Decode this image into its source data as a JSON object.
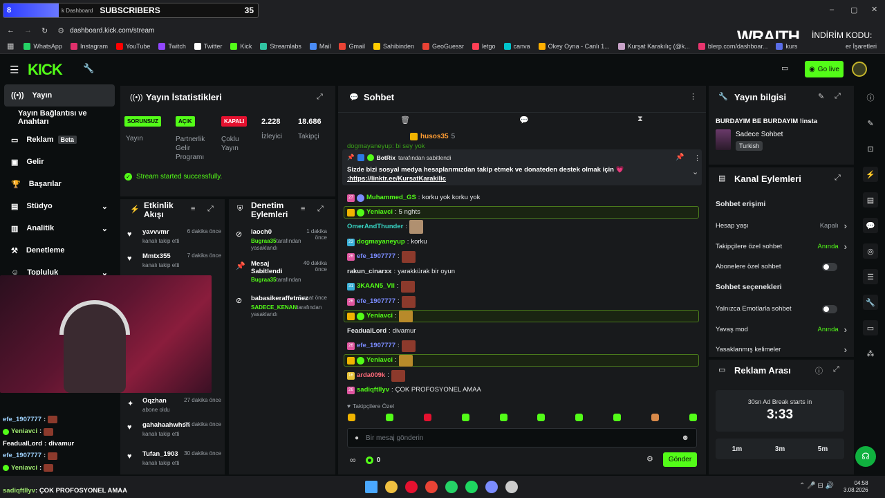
{
  "overlay": {
    "number": "8",
    "subs_label": "SUBSCRIBERS",
    "subs_count": "35",
    "brand": "WRAITH.",
    "promo": "İNDİRİM KODU:",
    "code": "QQ"
  },
  "browser": {
    "tab_fragment": "k Dashboard",
    "url": "dashboard.kick.com/stream",
    "bookmarks": [
      "WhatsApp",
      "Instagram",
      "YouTube",
      "Twitch",
      "Twitter",
      "Kick",
      "Streamlabs",
      "Mail",
      "Gmail",
      "Sahibinden",
      "GeoGuessr",
      "letgo",
      "canva",
      "Okey Oyna - Canlı 1...",
      "Kurşat Karakılıç (@k...",
      "blerp.com/dashboar...",
      "kurs"
    ],
    "bookmarks_end": "er İşaretleri"
  },
  "header": {
    "golive": "Go live"
  },
  "sidebar": {
    "items": [
      {
        "label": "Yayın"
      },
      {
        "label": "Yayın Bağlantısı ve Anahtarı"
      },
      {
        "label": "Reklam",
        "badge": "Beta"
      },
      {
        "label": "Gelir"
      },
      {
        "label": "Başarılar"
      },
      {
        "label": "Stüdyo"
      },
      {
        "label": "Analitik"
      },
      {
        "label": "Denetleme"
      },
      {
        "label": "Topluluk"
      }
    ]
  },
  "stats": {
    "title": "Yayın İstatistikleri",
    "cells": [
      {
        "badge": "SORUNSUZ",
        "label": "Yayın"
      },
      {
        "badge": "AÇIK",
        "label": "Partnerlik Gelir Programı"
      },
      {
        "badge": "KAPALI",
        "label": "Çoklu Yayın"
      },
      {
        "value": "2.228",
        "label": "İzleyici"
      },
      {
        "value": "18.686",
        "label": "Takipçi"
      }
    ],
    "success": "Stream started successfully."
  },
  "activity": {
    "title": "Etkinlik Akışı",
    "items": [
      {
        "name": "yavvvmr",
        "time": "6 dakika önce",
        "action": "kanalı takip etti"
      },
      {
        "name": "Mmtx355",
        "time": "7 dakika önce",
        "action": "kanalı takip etti"
      },
      {
        "name": "Oqzhan",
        "time": "27 dakika önce",
        "action": "abone oldu"
      },
      {
        "name": "gahahaahwhsh",
        "time": "27 dakika önce",
        "action": "kanalı takip etti"
      },
      {
        "name": "Tufan_1903",
        "time": "30 dakika önce",
        "action": "kanalı takip etti"
      }
    ]
  },
  "moderation": {
    "title": "Denetim Eylemleri",
    "items": [
      {
        "name": "laoch0",
        "time": "1 dakika önce",
        "by": "Bugraa35",
        "suffix": "tarafından yasaklandı"
      },
      {
        "name": "Mesaj Sabitlendi",
        "time": "40 dakika önce",
        "by": "Bugraa35",
        "suffix": "tarafından"
      },
      {
        "name": "babasikeraffetmez",
        "time": "3 saat önce",
        "by": "SADECE_KENAN",
        "suffix": "tarafından yasaklandı"
      }
    ]
  },
  "chat": {
    "title": "Sohbet",
    "top_user": "husos35",
    "top_count": "5",
    "partial": "dogmayaneyup: bi sey yok",
    "pinned_by": "BotRix",
    "pinned_suffix": "tarafından sabitlendi",
    "pinned_text": "Sizde bizi sosyal medya hesaplarımızdan takip etmek ve donateden destek olmak için 💗",
    "pinned_link": ";https://linktr.ee/KursatKarakilic",
    "messages": [
      {
        "user": "Muhammed_GS",
        "text": "korku yok korku yok",
        "color": "#53fc18",
        "badge": "27"
      },
      {
        "user": "Yeniavci",
        "text": "5 nghts",
        "color": "#53fc18",
        "hl": true
      },
      {
        "user": "OmerAndThunder",
        "text": "",
        "color": "#38d4c4",
        "emote": true
      },
      {
        "user": "dogmayaneyup",
        "text": "korku",
        "color": "#53fc18",
        "badge": "23"
      },
      {
        "user": "efe_1907777",
        "text": "",
        "color": "#7b8cff",
        "emote": true,
        "badge": "26"
      },
      {
        "user": "rakun_cinarxx",
        "text": "yarakkürak bir oyun",
        "color": "#e6e8ea"
      },
      {
        "user": "3KAAN5_Vll",
        "text": "",
        "color": "#53fc18",
        "emote": true,
        "badge": "31"
      },
      {
        "user": "efe_1907777",
        "text": "",
        "color": "#7b8cff",
        "emote": true,
        "badge": "26"
      },
      {
        "user": "Yeniavci",
        "text": "",
        "color": "#53fc18",
        "emote": true,
        "hl": true
      },
      {
        "user": "FeadualLord",
        "text": "divamur",
        "color": "#e6e8ea"
      },
      {
        "user": "efe_1907777",
        "text": "",
        "color": "#7b8cff",
        "emote": true,
        "badge": "26"
      },
      {
        "user": "Yeniavci",
        "text": "",
        "color": "#53fc18",
        "emote": true,
        "hl": true
      },
      {
        "user": "arda009k",
        "text": "",
        "color": "#ff6b7a",
        "emote": true,
        "badge": "16"
      },
      {
        "user": "sadiqftllyv",
        "text": "ÇOK PROFOSYONEL AMAA",
        "color": "#53fc18",
        "badge": "26"
      }
    ],
    "followers_only": "Takipçilere Özel",
    "input_placeholder": "Bir mesaj gönderin",
    "points": "0",
    "send": "Gönder"
  },
  "overlay_chat": [
    {
      "user": "efe_1907777",
      "text": ""
    },
    {
      "user": "Yeniavci",
      "text": ""
    },
    {
      "user": "FeadualLord",
      "text": "divamur"
    },
    {
      "user": "efe_1907777",
      "text": ""
    },
    {
      "user": "Yeniavci",
      "text": ""
    },
    {
      "user": "arda009k",
      "text": ""
    },
    {
      "user": "sadiqftllyv",
      "text": "ÇOK PROFOSYONEL AMAA"
    }
  ],
  "info": {
    "title": "Yayın bilgisi",
    "stream_title": "BURDAYIM BE BURDAYIM !insta",
    "category": "Sadece Sohbet",
    "language": "Turkish"
  },
  "channel": {
    "title": "Kanal Eylemleri",
    "access": "Sohbet erişimi",
    "rows1": [
      {
        "label": "Hesap yaşı",
        "value": "Kapalı"
      },
      {
        "label": "Takipçilere özel sohbet",
        "value": "Anında"
      },
      {
        "label": "Abonelere özel sohbet",
        "value": ""
      }
    ],
    "options": "Sohbet seçenekleri",
    "rows2": [
      {
        "label": "Yalnızca Emotlarla sohbet",
        "value": ""
      },
      {
        "label": "Yavaş mod",
        "value": "Anında"
      },
      {
        "label": "Yasaklanmış kelimeler",
        "value": ""
      }
    ]
  },
  "ad": {
    "title": "Reklam Arası",
    "caption": "30sn Ad Break starts in",
    "timer": "3:33",
    "options": [
      "1m",
      "3m",
      "5m"
    ]
  },
  "taskbar": {
    "time": "04:58",
    "date": "3.08.2026"
  }
}
